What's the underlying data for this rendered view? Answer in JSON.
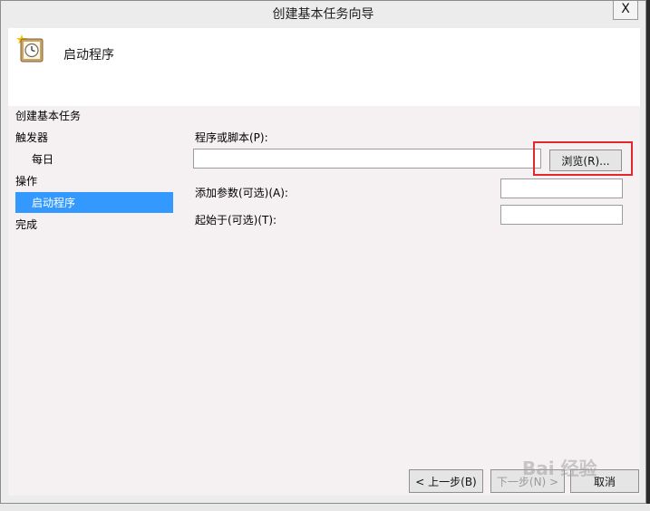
{
  "window": {
    "title": "创建基本任务向导",
    "close_label": "X"
  },
  "header": {
    "title": "启动程序",
    "icon": "scheduled-task-clock-icon"
  },
  "steps": [
    {
      "label": "创建基本任务"
    },
    {
      "label": "触发器"
    },
    {
      "label": "每日"
    },
    {
      "label": "操作"
    },
    {
      "label": "启动程序"
    },
    {
      "label": "完成"
    }
  ],
  "selected_step": "启动程序",
  "form": {
    "program_label": "程序或脚本(P):",
    "program_value": "",
    "browse_label": "浏览(R)...",
    "args_label": "添加参数(可选)(A):",
    "args_value": "",
    "start_in_label": "起始于(可选)(T):",
    "start_in_value": ""
  },
  "footer": {
    "back_label": "< 上一步(B)",
    "next_label": "下一步(N) >",
    "cancel_label": "取消"
  },
  "watermark": "Bai 经验",
  "colors": {
    "selection": "#3399ff",
    "highlight_box": "#e0282e",
    "content_bg": "#f5f1f3"
  }
}
